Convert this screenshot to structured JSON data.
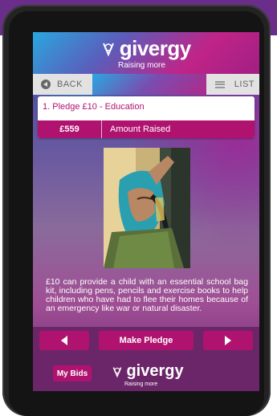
{
  "app": {
    "brand": "givergy",
    "tagline": "Raising more"
  },
  "nav": {
    "back_label": "BACK",
    "list_label": "LIST"
  },
  "pledge": {
    "title": "1. Pledge £10 - Education",
    "amount": "£559",
    "amount_label": "Amount Raised"
  },
  "description": "£10 can provide a child with an essential school bag kit, including pens, pencils and exercise books to help children who have had to flee their homes because of an emergency like war or natural disaster.",
  "actions": {
    "make_pledge_label": "Make Pledge",
    "my_bids_label": "My Bids"
  },
  "footer": {
    "brand": "givergy",
    "tagline": "Raising more"
  },
  "colors": {
    "accent": "#b0136f",
    "bottom_bar": "#6a2668",
    "nav_bg": "#e2e2e2"
  }
}
